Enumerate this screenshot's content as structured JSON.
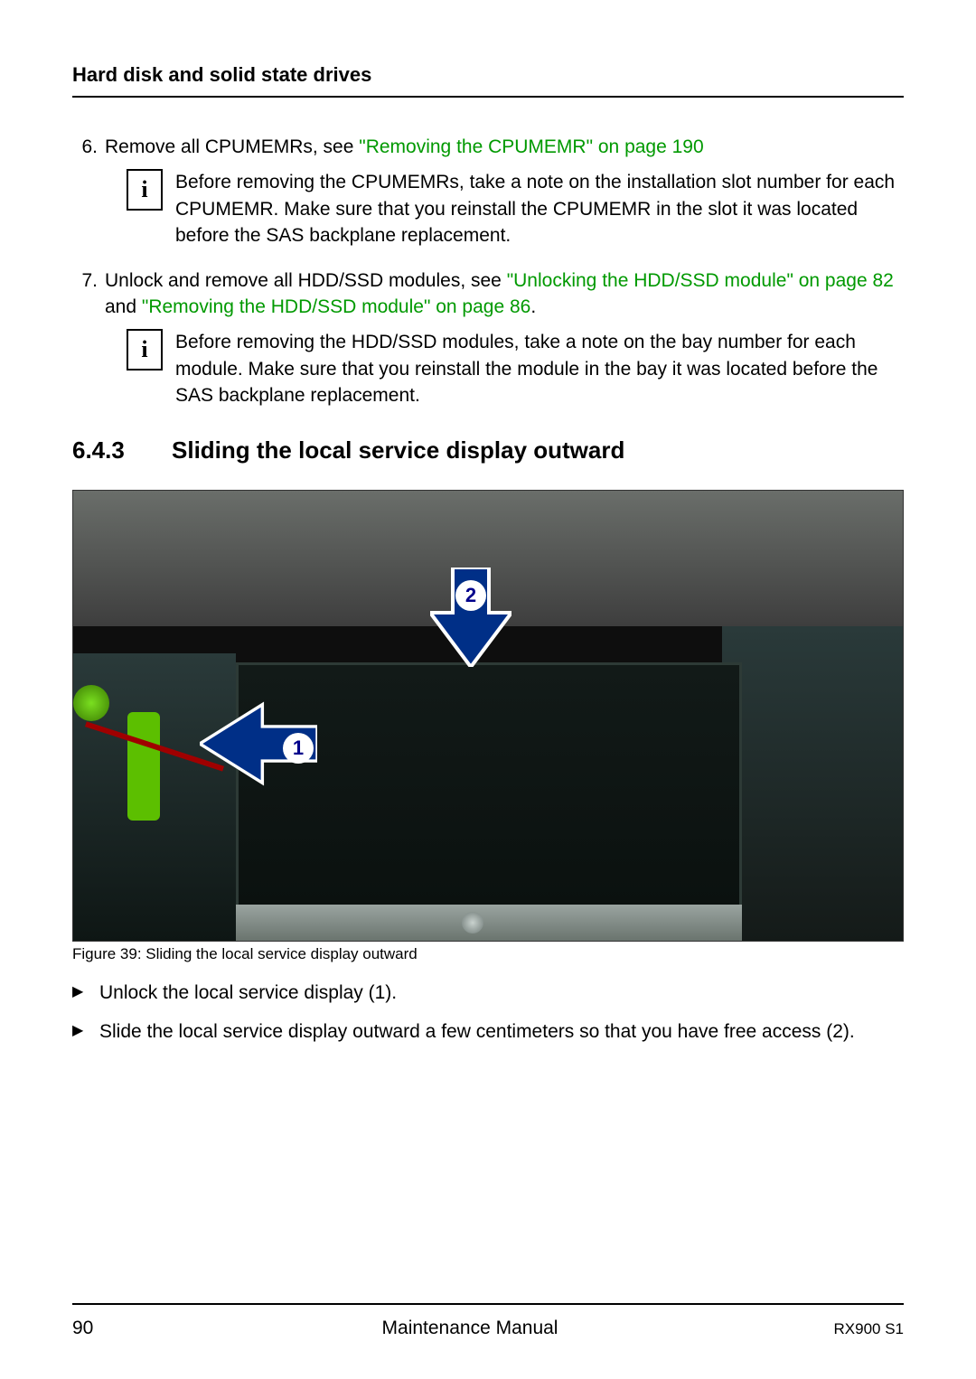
{
  "header": {
    "title": "Hard disk and solid state drives"
  },
  "items": [
    {
      "num": "6.",
      "text_before": "Remove all CPUMEMRs, see ",
      "link": "\"Removing the CPUMEMR\" on page 190",
      "text_after": "",
      "info": "Before removing the CPUMEMRs, take a note on the installation slot number for each CPUMEMR. Make sure that you reinstall the CPUMEMR in the slot it was located before the SAS backplane replacement."
    },
    {
      "num": "7.",
      "text_before": "Unlock and remove all HDD/SSD modules, see ",
      "link": "\"Unlocking the HDD/SSD module\" on page 82",
      "mid": " and ",
      "link2": "\"Removing the HDD/SSD module\" on page 86",
      "text_after": ".",
      "info": "Before removing the HDD/SSD modules, take a note on the bay number for each module. Make sure that you reinstall the module in the bay it was located before the SAS backplane replacement."
    }
  ],
  "section": {
    "number": "6.4.3",
    "title": "Sliding the local service display outward"
  },
  "figure": {
    "caption": "Figure 39: Sliding the local service display outward",
    "callout1": "1",
    "callout2": "2"
  },
  "bullets": [
    "Unlock the local service display (1).",
    "Slide the local service display outward a few centimeters so that you have free access (2)."
  ],
  "footer": {
    "page": "90",
    "manual": "Maintenance Manual",
    "model": "RX900 S1"
  },
  "info_glyph": "i"
}
